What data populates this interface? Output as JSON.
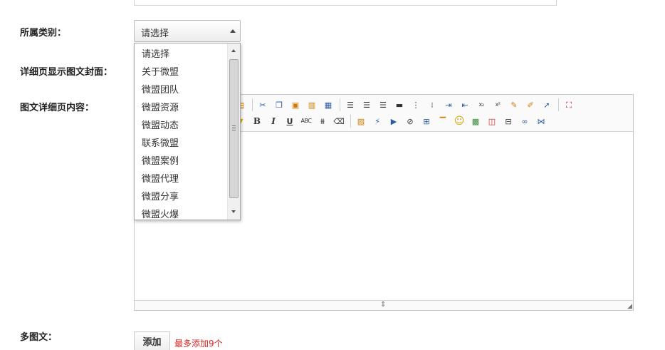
{
  "form": {
    "category_label": "所属类别：",
    "cover_label": "详细页显示图文封面：",
    "content_label": "图文详细页内容：",
    "multi_label": "多图文："
  },
  "category_select": {
    "selected": "请选择",
    "options": [
      "请选择",
      "关于微盟",
      "微盟团队",
      "微盟资源",
      "微盟动态",
      "联系微盟",
      "微盟案例",
      "微盟代理",
      "微盟分享",
      "微盟火爆"
    ]
  },
  "editor": {
    "toolbar_row1_icons": [
      "doc-icon",
      "cut-icon",
      "copy-icon",
      "paste-icon",
      "paste-text-icon",
      "paste-word-icon",
      "align-left-icon",
      "align-center-icon",
      "align-right-icon",
      "justify-icon",
      "ordered-list-icon",
      "unordered-list-icon",
      "indent-icon",
      "outdent-icon",
      "subscript-icon",
      "superscript-icon",
      "clear-format-icon",
      "select-all-icon",
      "cursor-icon",
      "fullscreen-icon"
    ],
    "toolbar_row2_icons": [
      "highlight-icon",
      "bold-icon",
      "italic-icon",
      "underline-icon",
      "strikethrough-icon",
      "line-height-icon",
      "eraser-icon",
      "image-icon",
      "flash-icon",
      "media-icon",
      "attach-icon",
      "table-icon",
      "hr-icon",
      "emoticon-icon",
      "picture-icon",
      "code-icon",
      "page-break-icon",
      "link-icon",
      "unlink-icon"
    ],
    "glyphs": {
      "bold": "B",
      "italic": "I",
      "underline": "U",
      "strike": "ABC",
      "subscript": "x₂",
      "superscript": "x²"
    }
  },
  "multi_image": {
    "add_label": "添加",
    "hint": "最多添加9个"
  },
  "colors": {
    "hint": "#e02020",
    "border": "#c8c8c8"
  }
}
